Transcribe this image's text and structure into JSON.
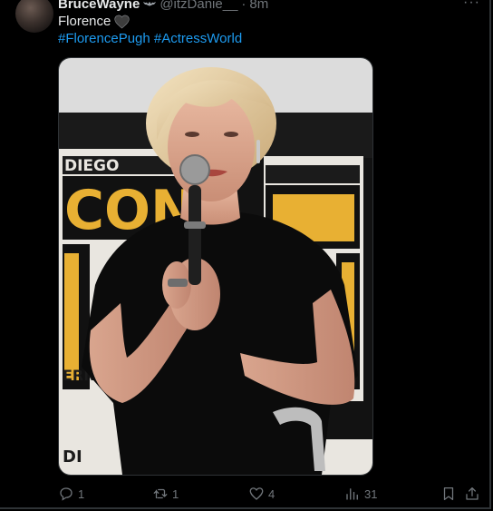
{
  "tweet": {
    "author_name": "BruceWayne",
    "badge_icon": "bat-icon",
    "handle": "@itzDanie__",
    "separator": "·",
    "time": "8m",
    "more_label": "···",
    "text": "Florence",
    "text_emoji_icon": "black-heart-icon",
    "hashtags": [
      "#FlorencePugh",
      "#ActressWorld"
    ]
  },
  "media": {
    "image_icon": "photo-woman-with-microphone",
    "backdrop_text": [
      "CON",
      "DIEGO",
      "ERNATI",
      "DI"
    ]
  },
  "actions": {
    "reply": {
      "icon": "reply-icon",
      "count": "1"
    },
    "retweet": {
      "icon": "retweet-icon",
      "count": "1"
    },
    "like": {
      "icon": "heart-outline-icon",
      "count": "4"
    },
    "views": {
      "icon": "views-icon",
      "count": "31"
    },
    "bookmark": {
      "icon": "bookmark-icon"
    },
    "share": {
      "icon": "share-icon"
    }
  },
  "colors": {
    "background": "#000000",
    "text": "#e7e9ea",
    "muted": "#71767b",
    "link": "#1d9bf0"
  }
}
